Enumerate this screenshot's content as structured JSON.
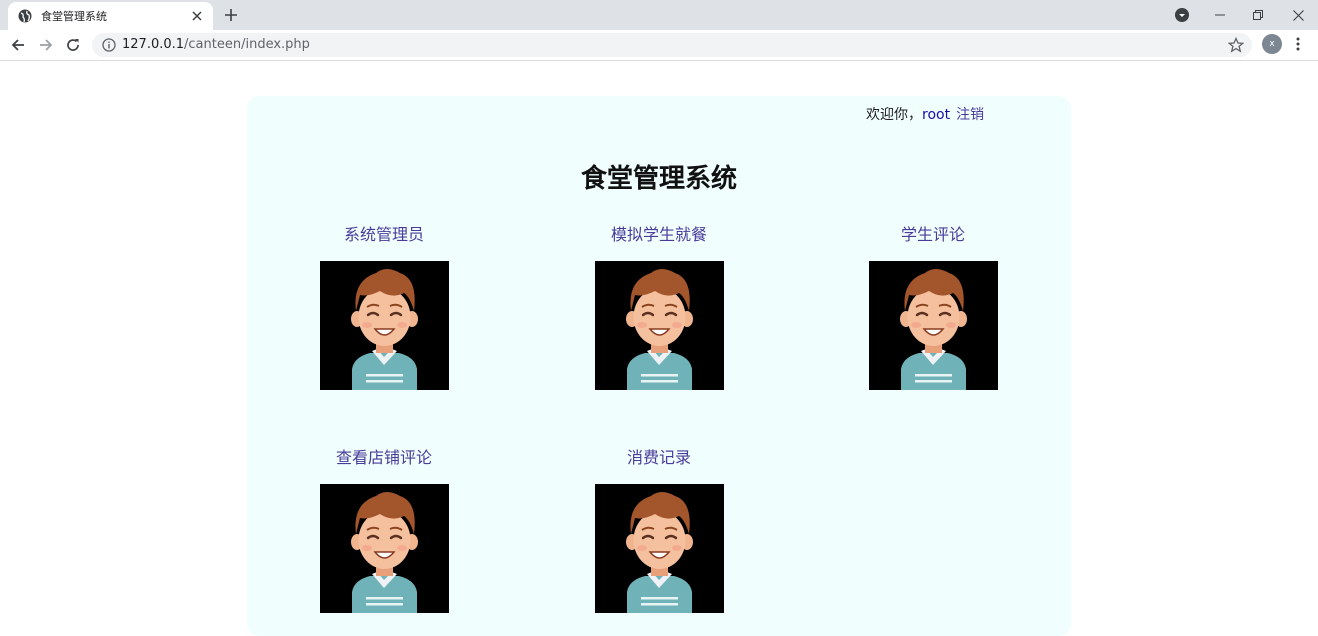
{
  "browser": {
    "tab_title": "食堂管理系统",
    "url_host": "127.0.0.1",
    "url_path": "/canteen/index.php",
    "profile_initial": "x"
  },
  "header": {
    "welcome_text": "欢迎你，",
    "username": "root",
    "logout_label": "注销"
  },
  "page": {
    "title": "食堂管理系统"
  },
  "menu": [
    {
      "label": "系统管理员",
      "icon": "avatar-cartoon-boy"
    },
    {
      "label": "模拟学生就餐",
      "icon": "avatar-cartoon-boy"
    },
    {
      "label": "学生评论",
      "icon": "avatar-cartoon-boy"
    },
    {
      "label": "查看店铺评论",
      "icon": "avatar-cartoon-boy"
    },
    {
      "label": "消费记录",
      "icon": "avatar-cartoon-boy"
    }
  ],
  "colors": {
    "panel_bg": "#f0fffe",
    "link": "#4a3b9a",
    "username": "#1a0dab"
  }
}
